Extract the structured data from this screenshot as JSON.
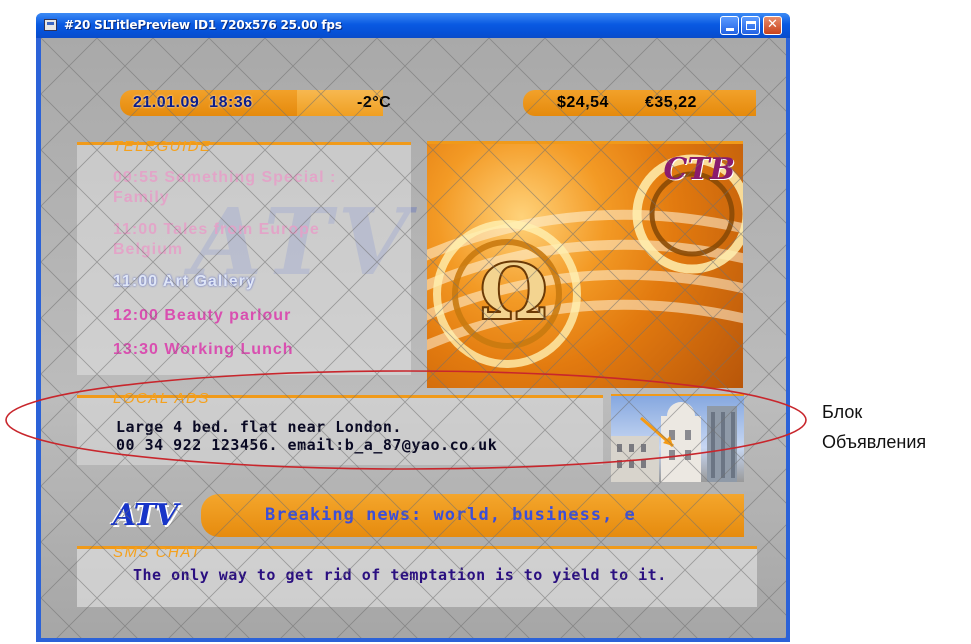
{
  "window": {
    "title": "#20 SLTitlePreview ID1 720x576 25.00 fps",
    "controls": {
      "minimize": "",
      "maximize": "",
      "close": "✕"
    }
  },
  "info_bar": {
    "date": "21.01.09",
    "time": "18:36",
    "temperature": "-2°C",
    "usd": "$24,54",
    "eur": "€35,22"
  },
  "teleguide": {
    "heading": "TELEGUIDE",
    "items": [
      {
        "time": "09:55",
        "title": "Something Special :",
        "cont": "Family"
      },
      {
        "time": "11:00",
        "title": "Tales from Europe",
        "cont": "Belgium"
      },
      {
        "time": "11:00",
        "title": "Art Gallery"
      },
      {
        "time": "12:00",
        "title": "Beauty parlour"
      },
      {
        "time": "13:30",
        "title": "Working Lunch"
      }
    ]
  },
  "video": {
    "logo": "CTB"
  },
  "local_ads": {
    "heading": "LOCAL ADS",
    "line1": "Large 4 bed. flat near London.",
    "line2": "00 34 922 123456. email:b_a_87@yao.co.uk"
  },
  "ticker": {
    "logo": "ATV",
    "text": "Breaking news: world, business, e"
  },
  "sms_chat": {
    "heading": "SMS CHAT",
    "message": "The only way to get rid of temptation is to yield to it."
  },
  "annotation": {
    "line1": "Блок",
    "line2": "Объявления",
    "ellipse_color": "#c8262c"
  },
  "colors": {
    "accent_orange": "#f09a1a",
    "frame_blue": "#2b62d8",
    "ticker_text": "#3c4fd8"
  }
}
